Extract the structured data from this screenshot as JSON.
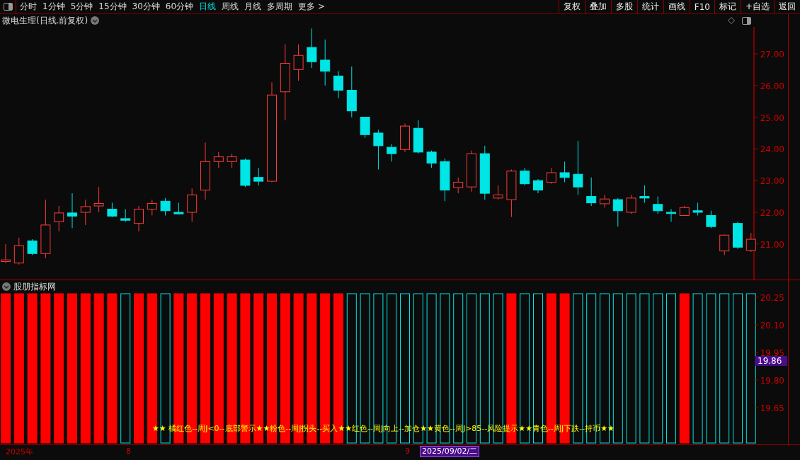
{
  "toolbar": {
    "periods": [
      {
        "label": "分时",
        "selected": false
      },
      {
        "label": "1分钟",
        "selected": false
      },
      {
        "label": "5分钟",
        "selected": false
      },
      {
        "label": "15分钟",
        "selected": false
      },
      {
        "label": "30分钟",
        "selected": false
      },
      {
        "label": "60分钟",
        "selected": false
      },
      {
        "label": "日线",
        "selected": true
      },
      {
        "label": "周线",
        "selected": false
      },
      {
        "label": "月线",
        "selected": false
      },
      {
        "label": "多周期",
        "selected": false
      },
      {
        "label": "更多 >",
        "selected": false
      }
    ],
    "buttons": [
      "复权",
      "叠加",
      "多股",
      "统计",
      "画线",
      "F10",
      "标记",
      "+自选",
      "返回"
    ]
  },
  "main_chart": {
    "title": "微电生理(日线.前复权)",
    "price_axis": [
      "27.00",
      "26.00",
      "25.00",
      "24.00",
      "23.00",
      "22.00",
      "21.00"
    ]
  },
  "indicator": {
    "title": "股朋指标网",
    "scale": [
      "20.25",
      "20.10",
      "19.95",
      "19.80",
      "19.65"
    ],
    "current_value": "19.86",
    "bars": [
      {
        "filled": true
      },
      {
        "filled": true
      },
      {
        "filled": true
      },
      {
        "filled": true
      },
      {
        "filled": true
      },
      {
        "filled": true
      },
      {
        "filled": true
      },
      {
        "filled": true
      },
      {
        "filled": true
      },
      {
        "filled": false
      },
      {
        "filled": true
      },
      {
        "filled": true
      },
      {
        "filled": false
      },
      {
        "filled": true
      },
      {
        "filled": true
      },
      {
        "filled": true
      },
      {
        "filled": true
      },
      {
        "filled": true
      },
      {
        "filled": true
      },
      {
        "filled": true
      },
      {
        "filled": true
      },
      {
        "filled": true
      },
      {
        "filled": true
      },
      {
        "filled": true
      },
      {
        "filled": true
      },
      {
        "filled": true
      },
      {
        "filled": false
      },
      {
        "filled": false
      },
      {
        "filled": false
      },
      {
        "filled": false
      },
      {
        "filled": false
      },
      {
        "filled": false
      },
      {
        "filled": false
      },
      {
        "filled": false
      },
      {
        "filled": false
      },
      {
        "filled": false
      },
      {
        "filled": false
      },
      {
        "filled": false
      },
      {
        "filled": true
      },
      {
        "filled": false
      },
      {
        "filled": false
      },
      {
        "filled": true
      },
      {
        "filled": true
      },
      {
        "filled": false
      },
      {
        "filled": false
      },
      {
        "filled": false
      },
      {
        "filled": false
      },
      {
        "filled": false
      },
      {
        "filled": false
      },
      {
        "filled": false
      },
      {
        "filled": false
      },
      {
        "filled": true
      },
      {
        "filled": false
      },
      {
        "filled": false
      },
      {
        "filled": false
      },
      {
        "filled": false
      },
      {
        "filled": false
      }
    ],
    "legend": "★★ 橘红色--周J<0--底部警示★★粉色--周J拐头--买入★★红色--周J向上--加仓★★黄色--周J>85--风险提示★★青色--周J下跌--持币★★"
  },
  "date_axis": {
    "year": "2025年",
    "months": [
      "8",
      "9"
    ],
    "cursor_date": "2025/09/02/二"
  }
}
